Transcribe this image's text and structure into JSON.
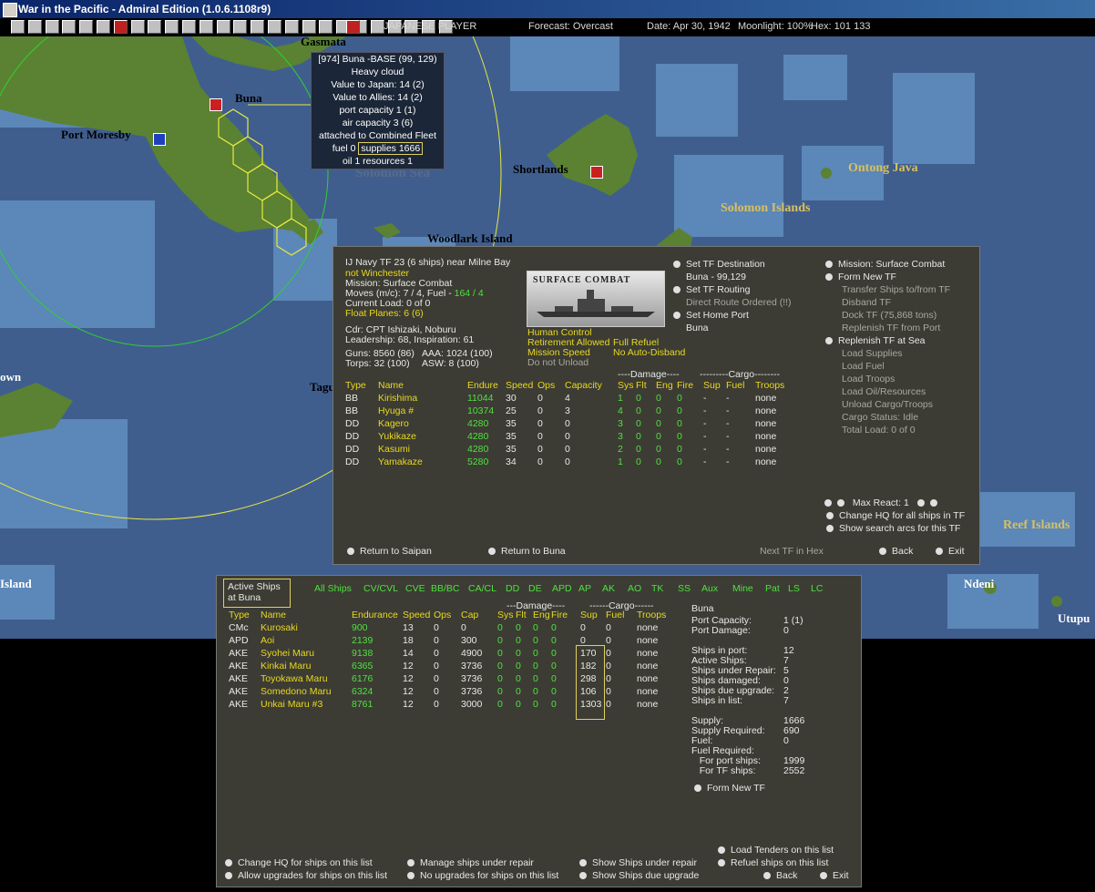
{
  "window": {
    "title": "War in the Pacific - Admiral Edition (1.0.6.1108r9)"
  },
  "toolbar": {
    "player": "JAPANESE PLAYER",
    "forecast": "Forecast: Overcast",
    "date": "Date: Apr 30, 1942",
    "moonlight": "Moonlight: 100%",
    "hex": "Hex: 101 133",
    "buttons": [
      "1",
      "2",
      "3",
      "4",
      "5",
      "6",
      "7",
      "8",
      "9",
      "10",
      "11",
      "12",
      "13",
      "14",
      "15",
      "16",
      "17",
      "18",
      "19",
      "20",
      "21",
      "22",
      "23",
      "24",
      "25",
      "26",
      "27"
    ]
  },
  "map": {
    "labels": [
      {
        "text": "Gasmata",
        "style": "black"
      },
      {
        "text": "Buna",
        "style": "black"
      },
      {
        "text": "Port Moresby",
        "style": "black"
      },
      {
        "text": "Solomon Sea",
        "style": "faded"
      },
      {
        "text": "Shortlands",
        "style": "black"
      },
      {
        "text": "Ontong Java",
        "style": "gold"
      },
      {
        "text": "Solomon Islands",
        "style": "gold"
      },
      {
        "text": "Woodlark Island",
        "style": "black"
      },
      {
        "text": "own",
        "style": "white"
      },
      {
        "text": "Tagu",
        "style": "black"
      },
      {
        "text": "Island",
        "style": "white"
      },
      {
        "text": "Reef Islands",
        "style": "gold"
      },
      {
        "text": "Ndeni",
        "style": "white"
      },
      {
        "text": "Utupu",
        "style": "white"
      }
    ]
  },
  "base_popup": {
    "lines": [
      "[974] Buna  -BASE (99, 129)",
      "Heavy cloud",
      "Value to Japan: 14 (2)",
      "Value to Allies: 14 (2)",
      "port capacity 1 (1)",
      "air capacity 3 (6)",
      "attached to Combined Fleet"
    ],
    "fuel": "fuel 0",
    "supplies": "supplies 1666",
    "oil": "oil 1  resources 1"
  },
  "tf_panel": {
    "header": "IJ Navy TF 23 (6 ships)  near Milne Bay",
    "status": "not Winchester",
    "mission": "Mission: Surface Combat",
    "moves": "Moves (m/c): 7 / 4, Fuel - ",
    "moves_fuel": "164 / 4",
    "current_load": "Current Load:  0 of 0",
    "float_planes": "Float Planes: 6 (6)",
    "cdr": "Cdr: CPT Ishizaki, Noburu",
    "leadership": "Leadership: 68, Inspiration: 61",
    "guns": "Guns: 8560 (86)",
    "aaa": "AAA: 1024 (100)",
    "torps": "Torps: 32 (100)",
    "asw": "ASW: 8 (100)",
    "photo_title": "SURFACE COMBAT",
    "flags": [
      "Human Control",
      "Retirement Allowed",
      "Mission Speed",
      "Do not Unload",
      "Full Refuel",
      "No Auto-Disband"
    ],
    "mid_actions": [
      {
        "label": "Set TF Destination",
        "arrow": true,
        "color": "w"
      },
      {
        "label": "Buna - 99,129",
        "arrow": false,
        "color": "w"
      },
      {
        "label": "Set TF Routing",
        "arrow": true,
        "color": "w"
      },
      {
        "label": "Direct Route Ordered (!!)",
        "arrow": false,
        "color": "gr"
      },
      {
        "label": "Set Home Port",
        "arrow": true,
        "color": "w"
      },
      {
        "label": "Buna",
        "arrow": false,
        "color": "w"
      }
    ],
    "right_actions": [
      {
        "label": "Mission: Surface Combat",
        "arrow": true,
        "color": "w"
      },
      {
        "label": "Form New TF",
        "arrow": true,
        "color": "w"
      },
      {
        "label": "Transfer Ships to/from TF",
        "arrow": false,
        "color": "gr"
      },
      {
        "label": "Disband TF",
        "arrow": false,
        "color": "gr"
      },
      {
        "label": "Dock TF (75,868 tons)",
        "arrow": false,
        "color": "gr"
      },
      {
        "label": "Replenish TF from Port",
        "arrow": false,
        "color": "gr"
      },
      {
        "label": "Replenish TF at Sea",
        "arrow": true,
        "color": "w"
      },
      {
        "label": "Load Supplies",
        "arrow": false,
        "color": "gr"
      },
      {
        "label": "Load Fuel",
        "arrow": false,
        "color": "gr"
      },
      {
        "label": "Load Troops",
        "arrow": false,
        "color": "gr"
      },
      {
        "label": "Load Oil/Resources",
        "arrow": false,
        "color": "gr"
      },
      {
        "label": "Unload Cargo/Troops",
        "arrow": false,
        "color": "gr"
      },
      {
        "label": "Cargo Status: Idle",
        "arrow": false,
        "color": "gr"
      },
      {
        "label": "Total Load: 0 of 0",
        "arrow": false,
        "color": "gr"
      }
    ],
    "damage_group": "----Damage----",
    "cargo_group": "---------Cargo--------",
    "columns": [
      "Type",
      "Name",
      "Endure",
      "Speed",
      "Ops",
      "Capacity",
      "Sys",
      "Flt",
      "Eng",
      "Fire",
      "Sup",
      "Fuel",
      "Troops"
    ],
    "ships": [
      {
        "type": "BB",
        "name": "Kirishima",
        "endure": "11044",
        "speed": "30",
        "ops": "0",
        "capacity": "4",
        "sys": "1",
        "flt": "0",
        "eng": "0",
        "fire": "0",
        "sup": "-",
        "fuel": "-",
        "troops": "none"
      },
      {
        "type": "BB",
        "name": "Hyuga #",
        "endure": "10374",
        "speed": "25",
        "ops": "0",
        "capacity": "3",
        "sys": "4",
        "flt": "0",
        "eng": "0",
        "fire": "0",
        "sup": "-",
        "fuel": "-",
        "troops": "none"
      },
      {
        "type": "DD",
        "name": "Kagero",
        "endure": "4280",
        "speed": "35",
        "ops": "0",
        "capacity": "0",
        "sys": "3",
        "flt": "0",
        "eng": "0",
        "fire": "0",
        "sup": "-",
        "fuel": "-",
        "troops": "none"
      },
      {
        "type": "DD",
        "name": "Yukikaze",
        "endure": "4280",
        "speed": "35",
        "ops": "0",
        "capacity": "0",
        "sys": "3",
        "flt": "0",
        "eng": "0",
        "fire": "0",
        "sup": "-",
        "fuel": "-",
        "troops": "none"
      },
      {
        "type": "DD",
        "name": "Kasumi",
        "endure": "4280",
        "speed": "35",
        "ops": "0",
        "capacity": "0",
        "sys": "2",
        "flt": "0",
        "eng": "0",
        "fire": "0",
        "sup": "-",
        "fuel": "-",
        "troops": "none"
      },
      {
        "type": "DD",
        "name": "Yamakaze",
        "endure": "5280",
        "speed": "34",
        "ops": "0",
        "capacity": "0",
        "sys": "1",
        "flt": "0",
        "eng": "0",
        "fire": "0",
        "sup": "-",
        "fuel": "-",
        "troops": "none"
      }
    ],
    "max_react": "Max React:  1",
    "change_hq": "Change HQ for all ships in TF",
    "show_arcs": "Show search arcs for this TF",
    "return_saipan": "Return to Saipan",
    "return_buna": "Return to Buna",
    "next_tf": "Next TF in Hex",
    "back": "Back",
    "exit": "Exit"
  },
  "port_panel": {
    "active_label_1": "Active Ships",
    "active_label_2": "at Buna",
    "filters": [
      "All Ships",
      "CV/CVL",
      "CVE",
      "BB/BC",
      "CA/CL",
      "DD",
      "DE",
      "APD",
      "AP",
      "AK",
      "AO",
      "TK",
      "SS",
      "Aux",
      "Mine",
      "Pat",
      "LS",
      "LC"
    ],
    "damage_group": "---Damage----",
    "cargo_group": "------Cargo------",
    "columns": [
      "Type",
      "Name",
      "Endurance",
      "Speed",
      "Ops",
      "Cap",
      "Sys",
      "Flt",
      "Eng",
      "Fire",
      "Sup",
      "Fuel",
      "Troops"
    ],
    "ships": [
      {
        "type": "CMc",
        "name": "Kurosaki",
        "endurance": "900",
        "speed": "13",
        "ops": "0",
        "cap": "0",
        "sys": "0",
        "flt": "0",
        "eng": "0",
        "fire": "0",
        "sup": "0",
        "fuel": "0",
        "troops": "none"
      },
      {
        "type": "APD",
        "name": "Aoi",
        "endurance": "2139",
        "speed": "18",
        "ops": "0",
        "cap": "300",
        "sys": "0",
        "flt": "0",
        "eng": "0",
        "fire": "0",
        "sup": "0",
        "fuel": "0",
        "troops": "none"
      },
      {
        "type": "AKE",
        "name": "Syohei Maru",
        "endurance": "9138",
        "speed": "14",
        "ops": "0",
        "cap": "4900",
        "sys": "0",
        "flt": "0",
        "eng": "0",
        "fire": "0",
        "sup": "170",
        "fuel": "0",
        "troops": "none"
      },
      {
        "type": "AKE",
        "name": "Kinkai Maru",
        "endurance": "6365",
        "speed": "12",
        "ops": "0",
        "cap": "3736",
        "sys": "0",
        "flt": "0",
        "eng": "0",
        "fire": "0",
        "sup": "182",
        "fuel": "0",
        "troops": "none"
      },
      {
        "type": "AKE",
        "name": "Toyokawa Maru",
        "endurance": "6176",
        "speed": "12",
        "ops": "0",
        "cap": "3736",
        "sys": "0",
        "flt": "0",
        "eng": "0",
        "fire": "0",
        "sup": "298",
        "fuel": "0",
        "troops": "none"
      },
      {
        "type": "AKE",
        "name": "Somedono Maru",
        "endurance": "6324",
        "speed": "12",
        "ops": "0",
        "cap": "3736",
        "sys": "0",
        "flt": "0",
        "eng": "0",
        "fire": "0",
        "sup": "106",
        "fuel": "0",
        "troops": "none"
      },
      {
        "type": "AKE",
        "name": "Unkai Maru #3",
        "endurance": "8761",
        "speed": "12",
        "ops": "0",
        "cap": "3000",
        "sys": "0",
        "flt": "0",
        "eng": "0",
        "fire": "0",
        "sup": "1303",
        "fuel": "0",
        "troops": "none"
      }
    ],
    "port_name": "Buna",
    "stats_a": [
      {
        "k": "Port Capacity:",
        "v": "1 (1)"
      },
      {
        "k": "Port Damage:",
        "v": "0"
      }
    ],
    "stats_b": [
      {
        "k": "Ships in port:",
        "v": "12"
      },
      {
        "k": "Active Ships:",
        "v": "7"
      },
      {
        "k": "Ships under Repair:",
        "v": "5"
      },
      {
        "k": "Ships damaged:",
        "v": "0"
      },
      {
        "k": "Ships due upgrade:",
        "v": "2"
      },
      {
        "k": "Ships in list:",
        "v": "7"
      }
    ],
    "stats_c": [
      {
        "k": "Supply:",
        "v": "1666"
      },
      {
        "k": "Supply Required:",
        "v": "690"
      },
      {
        "k": "Fuel:",
        "v": "0"
      },
      {
        "k": "Fuel Required:",
        "v": ""
      },
      {
        "k": "   For port ships:",
        "v": "1999"
      },
      {
        "k": "   For TF ships:",
        "v": "2552"
      }
    ],
    "form_new_tf": "Form New TF",
    "load_tenders": "Load Tenders on this list",
    "refuel": "Refuel ships on this list",
    "change_hq": "Change HQ for ships on this list",
    "allow_upgrades": "Allow upgrades for ships on this list",
    "manage_repair": "Manage ships under repair",
    "no_upgrades": "No upgrades for ships on this list",
    "show_repair": "Show Ships under repair",
    "show_upgrade": "Show Ships due upgrade",
    "back": "Back",
    "exit": "Exit"
  },
  "colors": {
    "sea": "#3f5e8e",
    "shallow": "#5f8cbe",
    "land": "#5a8232",
    "panel": "#3c3c34",
    "highlight": "#e8d820",
    "green": "#50e040"
  }
}
